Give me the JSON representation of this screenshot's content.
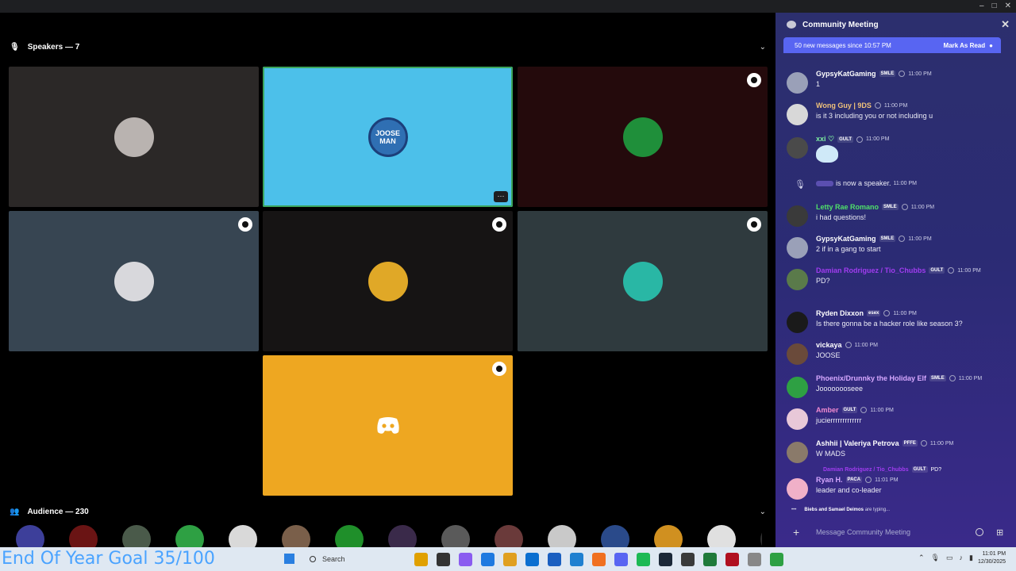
{
  "window": {
    "controls": [
      "–",
      "□",
      "✕"
    ]
  },
  "stage": {
    "speakers_header": "Speakers — 7",
    "audience_header": "Audience — 230",
    "speaker_tiles": [
      {
        "bg": "#2b2827",
        "avatar": "#b9b3b0",
        "label": "",
        "badge": false,
        "active": false
      },
      {
        "bg": "#4cc0ea",
        "avatar": "#2f6fb3",
        "label": "JOOSE MAN",
        "badge": false,
        "active": true
      },
      {
        "bg": "#240a0c",
        "avatar": "#1f8f3a",
        "label": "",
        "badge": true,
        "active": false
      },
      {
        "bg": "#374552",
        "avatar": "#d8d8dc",
        "label": "",
        "badge": true,
        "active": false
      },
      {
        "bg": "#161414",
        "avatar": "#e0a827",
        "label": "",
        "badge": true,
        "active": false
      },
      {
        "bg": "#2f3a3e",
        "avatar": "#29b7a5",
        "label": "",
        "badge": true,
        "active": false
      },
      {
        "bg": "#eea721",
        "avatar": "#ffffff",
        "label": "",
        "badge": true,
        "active": false
      }
    ],
    "audience_colors": [
      "#3d3f9a",
      "#6a1414",
      "#4a5a4a",
      "#2ea043",
      "#d9d9d9",
      "#7a5f4a",
      "#1f8f2a",
      "#3a2a4a",
      "#5a5a5a",
      "#6a3a3a",
      "#c9c9c9",
      "#2a4a8a",
      "#d09020",
      "#e0e0e0",
      "#303030"
    ]
  },
  "chat": {
    "title": "Community Meeting",
    "new_messages": "50 new messages since 10:57 PM",
    "mark_as_read": "Mark As Read",
    "messages": [
      {
        "name": "GypsyKatGaming",
        "name_color": "#ffffff",
        "tag": "SMLE",
        "time": "11:00 PM",
        "text": "1",
        "avatar": "#9aa0b8"
      },
      {
        "name": "Wong Guy | 9DS",
        "name_color": "#f0c27a",
        "tag": "",
        "time": "11:00 PM",
        "text": "is it 3 including you or not including u",
        "avatar": "#d8d8d8"
      },
      {
        "name": "xxi ♡",
        "name_color": "#7ef0a0",
        "tag": "GULT",
        "time": "11:00 PM",
        "text": "",
        "avatar": "#4a4a4a"
      },
      {
        "name": "Letty Rae Romano",
        "name_color": "#4fe06a",
        "tag": "SMLE",
        "time": "11:00 PM",
        "text": "i had questions!",
        "avatar": "#3a3a3a"
      },
      {
        "name": "GypsyKatGaming",
        "name_color": "#ffffff",
        "tag": "SMLE",
        "time": "11:00 PM",
        "text": "2 if in a gang to start",
        "avatar": "#9aa0b8"
      },
      {
        "name": "Damian Rodriguez / Tio_Chubbs",
        "name_color": "#a13cf0",
        "tag": "GULT",
        "time": "11:00 PM",
        "text": "PD?",
        "avatar": "#5a7a4a"
      },
      {
        "name": "Ryden Dixxon",
        "name_color": "#ffffff",
        "tag": "esex",
        "time": "11:00 PM",
        "text": "Is there gonna be a hacker role like season 3?",
        "avatar": "#1a1a1a"
      },
      {
        "name": "vickaya",
        "name_color": "#ffffff",
        "tag": "",
        "time": "11:00 PM",
        "text": "JOOSE",
        "avatar": "#6a4a3a"
      },
      {
        "name": "Phoenix/Drunnky the Holiday Elf",
        "name_color": "#d7a8ff",
        "tag": "SMLE",
        "time": "11:00 PM",
        "text": "Joooooooseee",
        "avatar": "#2ea043"
      },
      {
        "name": "Amber",
        "name_color": "#f08ad0",
        "tag": "GULT",
        "time": "11:00 PM",
        "text": "jucierrrrrrrrrrrrr",
        "avatar": "#e8c8d8"
      },
      {
        "name": "Ashhii | Valeriya Petrova",
        "name_color": "#ffffff",
        "tag": "PFFE",
        "time": "11:00 PM",
        "text": "W MADS",
        "avatar": "#8a7a6a"
      },
      {
        "name": "Ryan H.",
        "name_color": "#d7a8ff",
        "tag": "PACA",
        "time": "11:01 PM",
        "text": "leader and co-leader",
        "avatar": "#f0b0c8"
      }
    ],
    "system_message": {
      "text": "is now a speaker.",
      "time": "11:00 PM"
    },
    "reply_preview": {
      "name": "Damian Rodriguez / Tio_Chubbs",
      "tag": "GULT",
      "text": "PD?"
    },
    "typing": {
      "users": "Biebs and Samael Deimos",
      "suffix": "are typing..."
    },
    "composer_placeholder": "Message Community Meeting"
  },
  "taskbar": {
    "overlay_text": "End Of Year Goal 35/100",
    "search_label": "Search",
    "app_colors": [
      "#e0a000",
      "#333333",
      "#8a5cf0",
      "#1f7ae0",
      "#e0a020",
      "#0a6fd0",
      "#1a5fc0",
      "#1f80d0",
      "#f07020",
      "#5865f2",
      "#1db954",
      "#1b2838",
      "#3a3a3a",
      "#1f7a3a",
      "#b01020",
      "#888888",
      "#2ea043"
    ],
    "clock_time": "11:01 PM",
    "clock_date": "12/30/2025"
  }
}
